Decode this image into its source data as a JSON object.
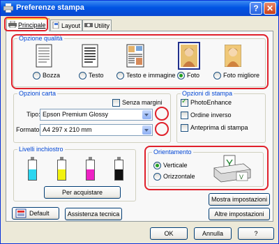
{
  "window": {
    "title": "Preferenze stampa"
  },
  "title_buttons": {
    "help": "?",
    "close": "✕"
  },
  "tabs": [
    {
      "label": "Principale",
      "icon": "printer-tab-icon",
      "active": true
    },
    {
      "label": "Layout",
      "icon": "layout-tab-icon",
      "active": false
    },
    {
      "label": "Utility",
      "icon": "utility-tab-icon",
      "active": false
    }
  ],
  "quality": {
    "legend": "Opzione qualità",
    "options": [
      {
        "label": "Bozza",
        "icon": "draft-document-icon",
        "selected": false
      },
      {
        "label": "Testo",
        "icon": "text-document-icon",
        "selected": false
      },
      {
        "label": "Testo e immagine",
        "icon": "text-image-document-icon",
        "selected": false
      },
      {
        "label": "Foto",
        "icon": "photo-icon",
        "selected": true
      },
      {
        "label": "Foto migliore",
        "icon": "best-photo-icon",
        "selected": false
      }
    ]
  },
  "paper": {
    "legend": "Opzioni carta",
    "borderless": {
      "label": "Senza margini",
      "checked": false
    },
    "type": {
      "label": "Tipo:",
      "value": "Epson Premium Glossy"
    },
    "size": {
      "label": "Formato:",
      "value": "A4 297 x 210 mm"
    }
  },
  "print_options": {
    "legend": "Opzioni di stampa",
    "items": [
      {
        "label": "PhotoEnhance",
        "checked": true
      },
      {
        "label": "Ordine inverso",
        "checked": false
      },
      {
        "label": "Anteprima di stampa",
        "checked": false
      }
    ]
  },
  "ink": {
    "legend": "Livelli inchiostro",
    "colors": [
      "#2bd6f0",
      "#f2f20e",
      "#ee22c4",
      "#111111"
    ],
    "levels": [
      0.55,
      0.55,
      0.55,
      0.55
    ],
    "buy_button": "Per acquistare"
  },
  "orientation": {
    "legend": "Orientamento",
    "options": [
      {
        "label": "Verticale",
        "selected": true
      },
      {
        "label": "Orizzontale",
        "selected": false
      }
    ]
  },
  "buttons": {
    "default": "Default",
    "support": "Assistenza tecnica",
    "show_settings": "Mostra impostazioni",
    "more_settings": "Altre impostazioni",
    "ok": "OK",
    "cancel": "Annulla",
    "help": "?"
  },
  "colors": {
    "accent": "#0046d5",
    "annotation": "#e0202a",
    "titlebar": "#0054e3"
  }
}
